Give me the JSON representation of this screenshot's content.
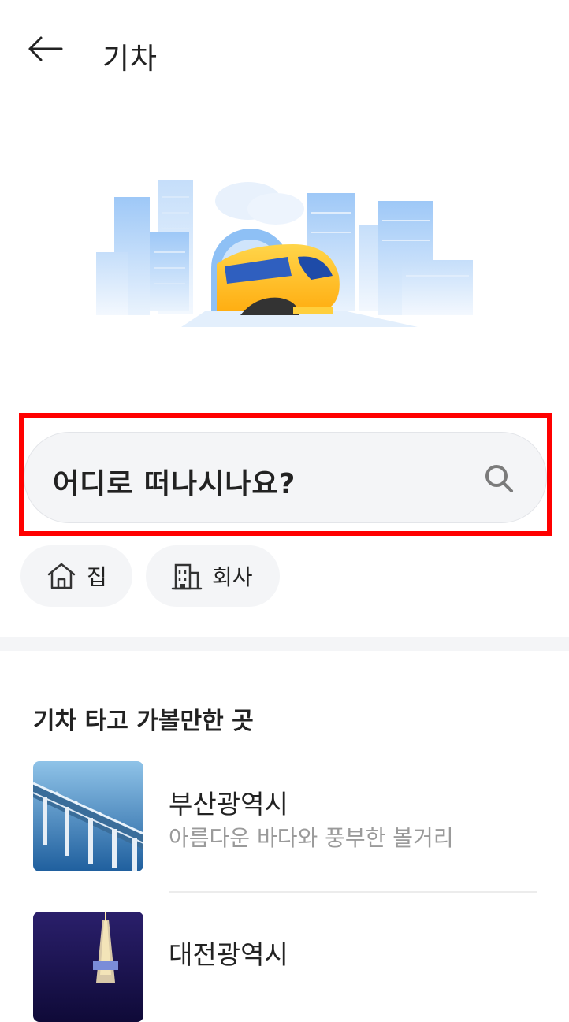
{
  "header": {
    "title": "기차",
    "back_icon": "arrow-left-icon"
  },
  "hero": {
    "illustration": "train-city-illustration"
  },
  "search": {
    "placeholder": "어디로 떠나시나요?",
    "icon": "search-icon"
  },
  "quick_chips": [
    {
      "label": "집",
      "icon": "home-icon"
    },
    {
      "label": "회사",
      "icon": "building-icon"
    }
  ],
  "recommend": {
    "title": "기차 타고 가볼만한 곳",
    "items": [
      {
        "name": "부산광역시",
        "desc": "아름다운 바다와 풍부한 볼거리",
        "thumb": "bridge-photo"
      },
      {
        "name": "대전광역시",
        "desc": "",
        "thumb": "night-tower-photo"
      }
    ]
  },
  "colors": {
    "highlight": "#ff0000",
    "search_bg": "#f4f5f7",
    "train_yellow": "#ffc21a",
    "building_blue": "#7fb3f0"
  }
}
